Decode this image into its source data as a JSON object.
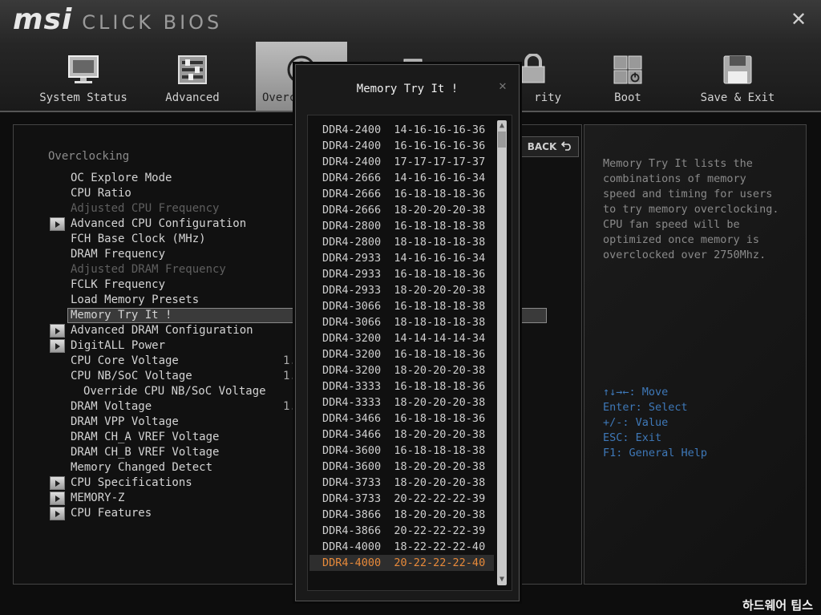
{
  "header": {
    "logo_brand": "msi",
    "logo_product": "CLICK BIOS",
    "close_glyph": "✕",
    "tabs": [
      {
        "label": "System Status",
        "icon": "monitor-icon"
      },
      {
        "label": "Advanced",
        "icon": "sliders-icon"
      },
      {
        "label": "Overc",
        "icon": "speedometer-icon"
      },
      {
        "label": "",
        "icon": "chip-icon"
      },
      {
        "label": "rity",
        "icon": "lock-icon"
      },
      {
        "label": "Boot",
        "icon": "power-grid-icon"
      },
      {
        "label": "Save & Exit",
        "icon": "floppy-disk-icon"
      }
    ]
  },
  "menu": {
    "section_title": "Overclocking",
    "items": [
      {
        "label": "OC Explore Mode",
        "value": ""
      },
      {
        "label": "CPU Ratio",
        "value": ""
      },
      {
        "label": "Adjusted CPU Frequency",
        "value": ""
      },
      {
        "label": "Advanced CPU Configuration",
        "value": ""
      },
      {
        "label": "FCH Base Clock (MHz)",
        "value": ""
      },
      {
        "label": "DRAM Frequency",
        "value": ""
      },
      {
        "label": "Adjusted DRAM Frequency",
        "value": ""
      },
      {
        "label": "FCLK Frequency",
        "value": ""
      },
      {
        "label": "Load Memory Presets",
        "value": ""
      },
      {
        "label": "Memory Try It !",
        "value": ""
      },
      {
        "label": "Advanced DRAM Configuration",
        "value": ""
      },
      {
        "label": "DigitALL Power",
        "value": ""
      },
      {
        "label": "CPU Core Voltage",
        "value": "1."
      },
      {
        "label": "CPU NB/SoC Voltage",
        "value": "1."
      },
      {
        "label": "Override CPU NB/SoC Voltage",
        "value": ""
      },
      {
        "label": "DRAM Voltage",
        "value": "1."
      },
      {
        "label": "DRAM VPP Voltage",
        "value": ""
      },
      {
        "label": "DRAM CH_A VREF Voltage",
        "value": ""
      },
      {
        "label": "DRAM CH_B VREF Voltage",
        "value": ""
      },
      {
        "label": "Memory Changed Detect",
        "value": ""
      },
      {
        "label": "CPU Specifications",
        "value": ""
      },
      {
        "label": "MEMORY-Z",
        "value": ""
      },
      {
        "label": "CPU Features",
        "value": ""
      }
    ]
  },
  "back_button": {
    "label": "BACK",
    "icon": "return-arrow-icon"
  },
  "help": {
    "description": "Memory Try It lists the\ncombinations of memory\nspeed and timing for users\nto try memory overclocking.\nCPU fan speed will be\noptimized once memory is\noverclocked over 2750Mhz.",
    "keys": [
      "↑↓→←: Move",
      "Enter: Select",
      "+/-: Value",
      "ESC: Exit",
      "F1: General Help"
    ]
  },
  "popup": {
    "title": "Memory Try It !",
    "close_glyph": "✕",
    "options": [
      "DDR4-2400  14-16-16-16-36",
      "DDR4-2400  16-16-16-16-36",
      "DDR4-2400  17-17-17-17-37",
      "DDR4-2666  14-16-16-16-34",
      "DDR4-2666  16-18-18-18-36",
      "DDR4-2666  18-20-20-20-38",
      "DDR4-2800  16-18-18-18-38",
      "DDR4-2800  18-18-18-18-38",
      "DDR4-2933  14-16-16-16-34",
      "DDR4-2933  16-18-18-18-36",
      "DDR4-2933  18-20-20-20-38",
      "DDR4-3066  16-18-18-18-38",
      "DDR4-3066  18-18-18-18-38",
      "DDR4-3200  14-14-14-14-34",
      "DDR4-3200  16-18-18-18-36",
      "DDR4-3200  18-20-20-20-38",
      "DDR4-3333  16-18-18-18-36",
      "DDR4-3333  18-20-20-20-38",
      "DDR4-3466  16-18-18-18-36",
      "DDR4-3466  18-20-20-20-38",
      "DDR4-3600  16-18-18-18-38",
      "DDR4-3600  18-20-20-20-38",
      "DDR4-3733  18-20-20-20-38",
      "DDR4-3733  20-22-22-22-39",
      "DDR4-3866  18-20-20-20-38",
      "DDR4-3866  20-22-22-22-39",
      "DDR4-4000  18-22-22-22-40",
      "DDR4-4000  20-22-22-22-40"
    ],
    "selected_index": 27
  },
  "watermark": "하드웨어 팁스",
  "colors": {
    "accent_selected": "#e88a3a",
    "help_keys": "#3e78b8"
  }
}
